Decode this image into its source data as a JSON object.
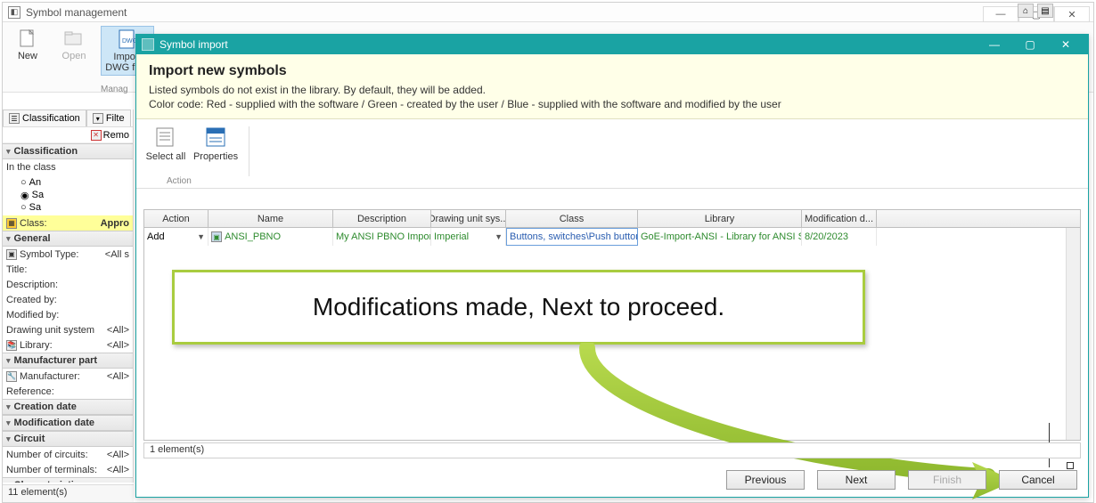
{
  "main_window": {
    "title": "Symbol management",
    "status": "11 element(s)"
  },
  "ribbon": {
    "new": "New",
    "open": "Open",
    "import": "Import DWG files",
    "group": "Manag"
  },
  "left_panel": {
    "tab_classification": "Classification",
    "tab_filter": "Filte",
    "remove": "Remo",
    "sec_classification": "Classification",
    "in_class": "In the class",
    "radio_an": "An",
    "radio_sa1": "Sa",
    "radio_sa2": "Sa",
    "class_label": "Class:",
    "class_value": "Appro",
    "sec_general": "General",
    "symbol_type": "Symbol Type:",
    "symbol_type_v": "<All s",
    "title_lbl": "Title:",
    "desc_lbl": "Description:",
    "created_lbl": "Created by:",
    "modified_lbl": "Modified by:",
    "drawing_unit_lbl": "Drawing unit system",
    "drawing_unit_v": "<All>",
    "library_lbl": "Library:",
    "library_v": "<All>",
    "sec_manufacturer": "Manufacturer part",
    "manufacturer_lbl": "Manufacturer:",
    "manufacturer_v": "<All>",
    "reference_lbl": "Reference:",
    "sec_creation": "Creation date",
    "sec_modification": "Modification date",
    "sec_circuit": "Circuit",
    "circuits_lbl": "Number of circuits:",
    "circuits_v": "<All>",
    "terminals_lbl": "Number of terminals:",
    "terminals_v": "<All>",
    "sec_characteristics": "Characteristics"
  },
  "child": {
    "title": "Symbol import",
    "heading": "Import new symbols",
    "desc1": "Listed symbols do not exist in the library. By default, they will be added.",
    "desc2": "Color code: Red - supplied with the software / Green - created by the user / Blue - supplied with the software and modified by the user",
    "select_all": "Select all",
    "properties": "Properties",
    "action_group": "Action",
    "status": "1 element(s)",
    "btn_prev": "Previous",
    "btn_next": "Next",
    "btn_finish": "Finish",
    "btn_cancel": "Cancel"
  },
  "table": {
    "headers": {
      "action": "Action",
      "name": "Name",
      "desc": "Description",
      "unit": "Drawing unit sys...",
      "class": "Class",
      "lib": "Library",
      "mod": "Modification d..."
    },
    "rows": [
      {
        "action": "Add",
        "name": "ANSI_PBNO",
        "desc": "My ANSI PBNO Import ...",
        "unit": "Imperial",
        "class": "Buttons, switches\\Push buttons...",
        "lib": "GoE-Import-ANSI - Library for ANSI Std...",
        "mod": "8/20/2023"
      }
    ]
  },
  "callout": "Modifications made, Next to proceed."
}
